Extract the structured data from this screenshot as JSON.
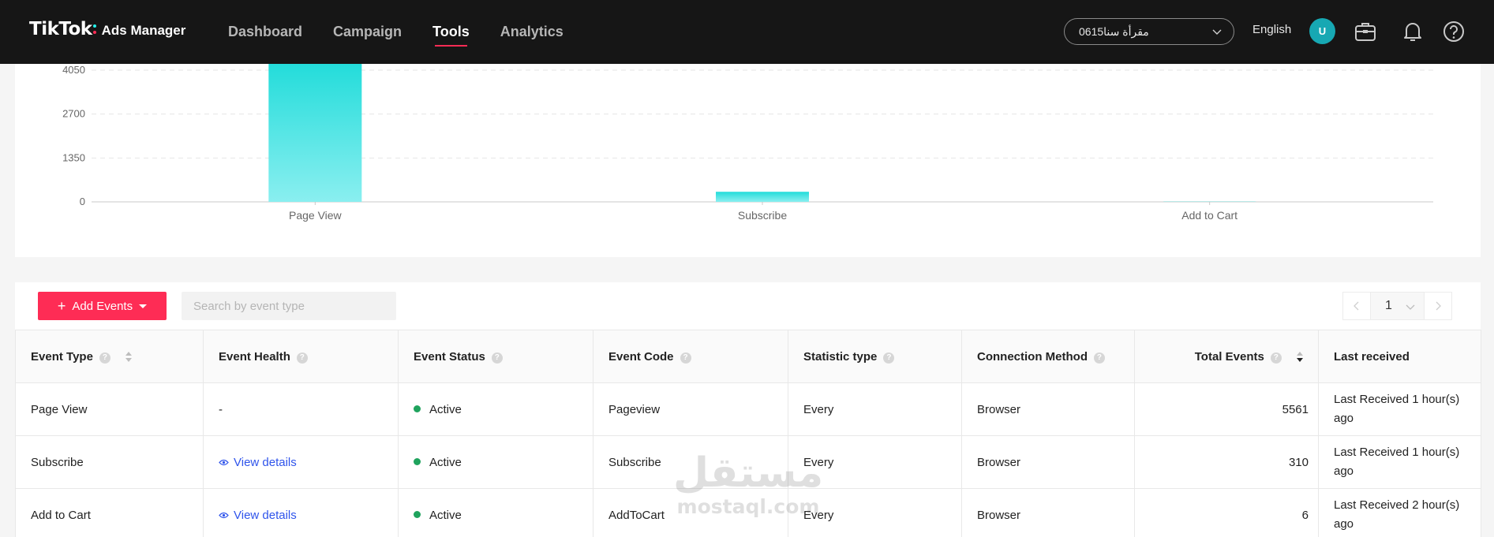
{
  "header": {
    "logo_brand": "TikTok",
    "logo_sub": "Ads Manager",
    "nav": [
      {
        "label": "Dashboard",
        "active": false
      },
      {
        "label": "Campaign",
        "active": false
      },
      {
        "label": "Tools",
        "active": true
      },
      {
        "label": "Analytics",
        "active": false
      }
    ],
    "account": "مقرأة سنا0615",
    "language": "English",
    "avatar_initial": "U",
    "icons": [
      "briefcase-icon",
      "bell-icon",
      "help-icon"
    ]
  },
  "chart_data": {
    "type": "bar",
    "categories": [
      "Page View",
      "Subscribe",
      "Add to Cart"
    ],
    "values": [
      5561,
      310,
      6
    ],
    "ylim": [
      0,
      4050
    ],
    "yticks": [
      0,
      1350,
      2700,
      4050
    ],
    "ytick_labels": [
      "0",
      "1350",
      "2700",
      "4050"
    ],
    "grid": true,
    "bar_color": "#25e2e0"
  },
  "events": {
    "add_button_label": "Add Events",
    "search_placeholder": "Search by event type",
    "page": "1",
    "columns": [
      {
        "label": "Event Type",
        "help": true,
        "sort": "both"
      },
      {
        "label": "Event Health",
        "help": true
      },
      {
        "label": "Event Status",
        "help": true
      },
      {
        "label": "Event Code",
        "help": true
      },
      {
        "label": "Statistic type",
        "help": true
      },
      {
        "label": "Connection Method",
        "help": true
      },
      {
        "label": "Total Events",
        "help": true,
        "sort": "desc"
      },
      {
        "label": "Last received",
        "help": false
      }
    ],
    "rows": [
      {
        "type": "Page View",
        "health": "-",
        "health_link": false,
        "status": "Active",
        "code": "Pageview",
        "stat": "Every",
        "method": "Browser",
        "total": "5561",
        "last": "Last Received 1 hour(s) ago"
      },
      {
        "type": "Subscribe",
        "health": "View details",
        "health_link": true,
        "status": "Active",
        "code": "Subscribe",
        "stat": "Every",
        "method": "Browser",
        "total": "310",
        "last": "Last Received 1 hour(s) ago"
      },
      {
        "type": "Add to Cart",
        "health": "View details",
        "health_link": true,
        "status": "Active",
        "code": "AddToCart",
        "stat": "Every",
        "method": "Browser",
        "total": "6",
        "last": "Last Received 2 hour(s) ago"
      }
    ]
  },
  "watermark": {
    "arabic": "مستقل",
    "latin": "mostaql.com"
  }
}
